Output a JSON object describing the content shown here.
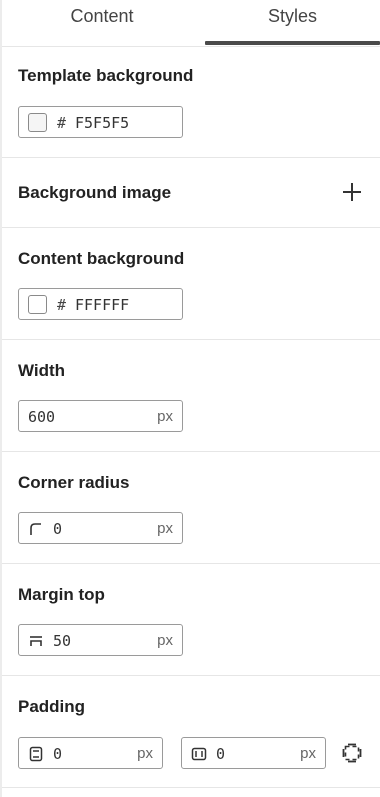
{
  "tabs": {
    "content_label": "Content",
    "styles_label": "Styles"
  },
  "template_background": {
    "title": "Template background",
    "hash": "#",
    "value": "F5F5F5",
    "color": "#F5F5F5"
  },
  "background_image": {
    "title": "Background image",
    "add_icon": "plus-icon"
  },
  "content_background": {
    "title": "Content background",
    "hash": "#",
    "value": "FFFFFF",
    "color": "#FFFFFF"
  },
  "width": {
    "title": "Width",
    "value": "600",
    "unit": "px"
  },
  "corner_radius": {
    "title": "Corner radius",
    "value": "0",
    "unit": "px",
    "icon": "corner-radius-icon"
  },
  "margin_top": {
    "title": "Margin top",
    "value": "50",
    "unit": "px",
    "icon": "margin-top-icon"
  },
  "padding": {
    "title": "Padding",
    "vertical_value": "0",
    "vertical_unit": "px",
    "horizontal_value": "0",
    "horizontal_unit": "px",
    "vertical_icon": "padding-vertical-icon",
    "horizontal_icon": "padding-horizontal-icon",
    "toggle_icon": "padding-individual-sides-icon"
  }
}
